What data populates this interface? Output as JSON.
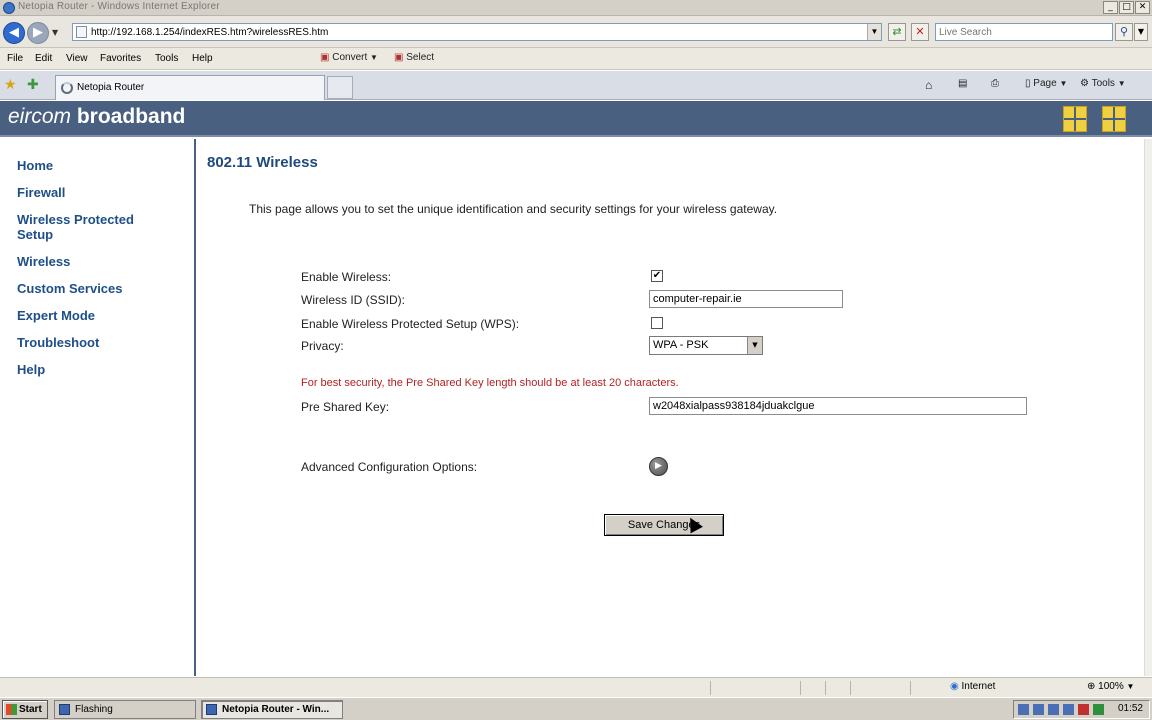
{
  "window": {
    "title": "Netopia Router - Windows Internet Explorer",
    "min": "_",
    "max": "□",
    "close": "✕"
  },
  "browser": {
    "url": "http://192.168.1.254/indexRES.htm?wirelessRES.htm",
    "search_placeholder": "Live Search",
    "menu": [
      "File",
      "Edit",
      "View",
      "Favorites",
      "Tools",
      "Help"
    ],
    "toolbar": {
      "convert": "Convert",
      "select": "Select"
    },
    "tab_title": "Netopia Router",
    "commands": {
      "page": "Page",
      "tools": "Tools"
    }
  },
  "banner": {
    "brand_light": "eircom",
    "brand_bold": "broadband"
  },
  "sidebar": {
    "items": [
      {
        "label": "Home"
      },
      {
        "label": "Firewall"
      },
      {
        "label": "Wireless Protected Setup"
      },
      {
        "label": "Wireless"
      },
      {
        "label": "Custom Services"
      },
      {
        "label": "Expert Mode"
      },
      {
        "label": "Troubleshoot"
      },
      {
        "label": "Help"
      }
    ]
  },
  "main": {
    "title": "802.11 Wireless",
    "intro": "This page allows you to set the unique identification and security settings for your wireless gateway.",
    "form": {
      "enable_wireless_label": "Enable Wireless:",
      "enable_wireless_checked": true,
      "ssid_label": "Wireless ID (SSID):",
      "ssid_value": "computer-repair.ie",
      "wps_label": "Enable Wireless Protected Setup (WPS):",
      "wps_checked": false,
      "privacy_label": "Privacy:",
      "privacy_value": "WPA - PSK",
      "psk_warning": "For best security, the Pre Shared Key length should be at least 20 characters.",
      "psk_label": "Pre Shared Key:",
      "psk_value": "w2048xialpass938184jduakclgue",
      "advanced_label": "Advanced Configuration Options:",
      "save_label": "Save Changes"
    }
  },
  "statusbar": {
    "zone": "Internet",
    "zoom": "100%"
  },
  "taskbar": {
    "start": "Start",
    "tasks": [
      {
        "label": "Flashing"
      },
      {
        "label": "Netopia Router - Win..."
      }
    ],
    "clock": "01:52"
  }
}
